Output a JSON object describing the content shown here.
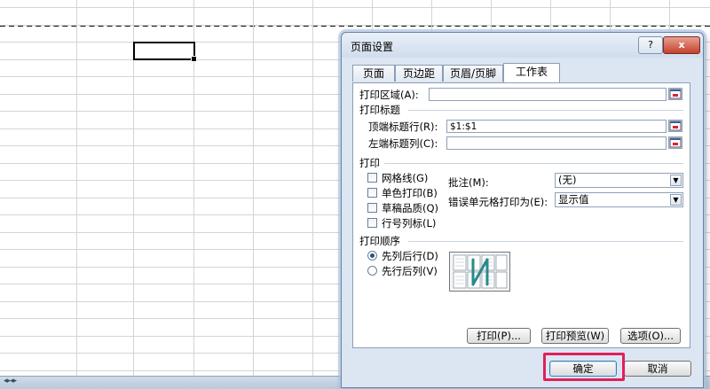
{
  "dialog": {
    "title": "页面设置",
    "help_label": "?",
    "close_label": "x",
    "tabs": [
      {
        "label": "页面"
      },
      {
        "label": "页边距"
      },
      {
        "label": "页眉/页脚"
      },
      {
        "label": "工作表"
      }
    ],
    "active_tab": "工作表",
    "print_area": {
      "label": "打印区域(A):",
      "value": ""
    },
    "print_titles": {
      "heading": "打印标题",
      "rows": {
        "label": "顶端标题行(R):",
        "value": "$1:$1"
      },
      "cols": {
        "label": "左端标题列(C):",
        "value": ""
      }
    },
    "print": {
      "heading": "打印",
      "checkboxes": [
        {
          "label": "网格线(G)",
          "checked": false
        },
        {
          "label": "单色打印(B)",
          "checked": false
        },
        {
          "label": "草稿品质(Q)",
          "checked": false
        },
        {
          "label": "行号列标(L)",
          "checked": false
        }
      ],
      "comments": {
        "label": "批注(M):",
        "value": "(无)"
      },
      "errors": {
        "label": "错误单元格打印为(E):",
        "value": "显示值"
      }
    },
    "page_order": {
      "heading": "打印顺序",
      "options": [
        {
          "label": "先列后行(D)",
          "selected": true
        },
        {
          "label": "先行后列(V)",
          "selected": false
        }
      ]
    },
    "buttons": {
      "print": "打印(P)...",
      "preview": "打印预览(W)",
      "options": "选项(O)...",
      "ok": "确定",
      "cancel": "取消"
    }
  },
  "colors": {
    "highlight": "#e0205a",
    "dialog_bg": "#dce6f3",
    "preview_arrow": "#2a8a8a"
  }
}
